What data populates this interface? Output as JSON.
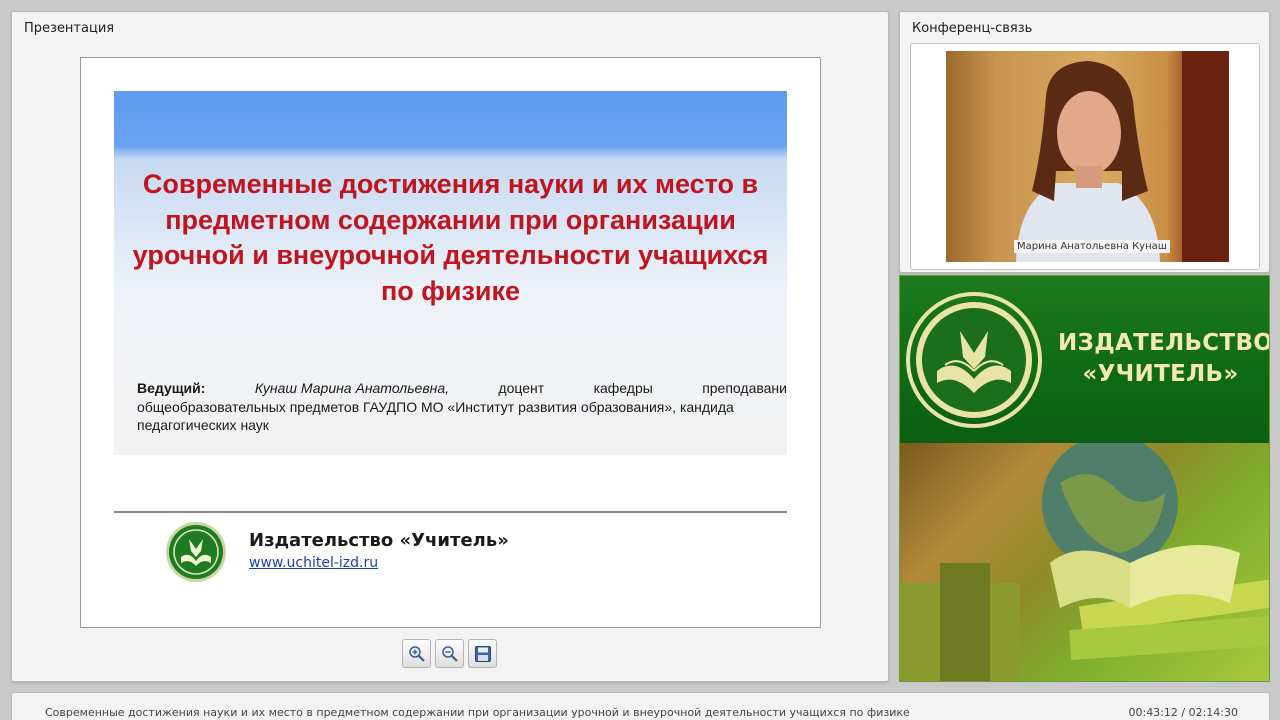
{
  "presentation": {
    "panel_title": "Презентация",
    "slide": {
      "title": "Современные достижения науки и их место в предметном содержании при организации урочной и внеурочной деятельности учащихся по физике",
      "presenter_label": "Ведущий:",
      "presenter_name": "Кунаш Марина Анатольевна,",
      "presenter_role_1a": "доцент",
      "presenter_role_1b": "кафедры",
      "presenter_role_1c": "преподавани",
      "presenter_role_2": "общеобразовательных предметов ГАУДПО МО «Институт развития образования», кандида",
      "presenter_role_3": "педагогических наук",
      "publisher_name": "Издательство «Учитель»",
      "publisher_url": "www.uchitel-izd.ru"
    },
    "toolbar": {
      "zoom_in_icon": "zoom-in-icon",
      "zoom_out_icon": "zoom-out-icon",
      "save_icon": "save-icon"
    }
  },
  "conference": {
    "panel_title": "Конференц-связь",
    "participant_name": "Марина Анатольевна Кунаш"
  },
  "brand": {
    "line1": "ИЗДАТЕЛЬСТВО",
    "line2": "«УЧИТЕЛЬ»"
  },
  "bottom_bar": {
    "title": "Современные достижения науки и их место в предметном содержании при организации урочной и внеурочной деятельности учащихся по физике",
    "time": "00:43:12 / 02:14:30"
  }
}
